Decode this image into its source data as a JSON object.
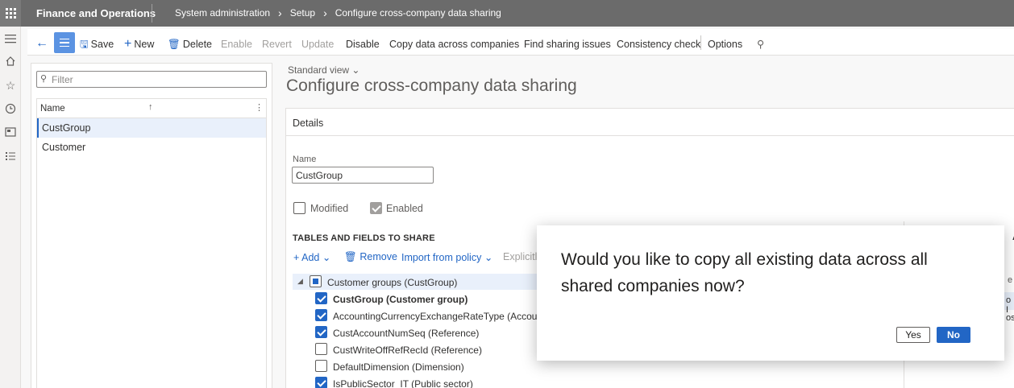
{
  "topbar": {
    "app_title": "Finance and Operations",
    "breadcrumbs": [
      "System administration",
      "Setup",
      "Configure cross-company data sharing"
    ]
  },
  "icons": {
    "waffle": "waffle-icon",
    "hamburger": "hamburger-icon",
    "home": "home-icon",
    "favorites": "star-icon",
    "recent": "clock-icon",
    "workspaces": "workspaces-icon",
    "modules": "list-icon"
  },
  "actionpane": {
    "save": "Save",
    "new": "New",
    "delete": "Delete",
    "enable": "Enable",
    "revert": "Revert",
    "update": "Update",
    "disable": "Disable",
    "copy_data": "Copy data across companies",
    "find_issues": "Find sharing issues",
    "consistency": "Consistency check",
    "options": "Options"
  },
  "list": {
    "filter_placeholder": "Filter",
    "column": "Name",
    "rows": [
      "CustGroup",
      "Customer"
    ]
  },
  "main": {
    "view": "Standard view",
    "title": "Configure cross-company data sharing",
    "details_header": "Details",
    "name_label": "Name",
    "name_value": "CustGroup",
    "modified_label": "Modified",
    "enabled_label": "Enabled",
    "section_title": "TABLES AND FIELDS TO SHARE",
    "toolbar": {
      "add": "Add",
      "remove": "Remove",
      "import": "Import from policy",
      "explicitly": "Explicitly"
    },
    "tree": {
      "root": "Customer groups (CustGroup)",
      "fields": [
        {
          "label": "CustGroup (Customer group)",
          "checked": true,
          "bold": true
        },
        {
          "label": "AccountingCurrencyExchangeRateType (Account",
          "checked": true,
          "bold": false
        },
        {
          "label": "CustAccountNumSeq (Reference)",
          "checked": true,
          "bold": false
        },
        {
          "label": "CustWriteOffRefRecId (Reference)",
          "checked": false,
          "bold": false
        },
        {
          "label": "DefaultDimension (Dimension)",
          "checked": false,
          "bold": false
        },
        {
          "label": "IsPublicSector_IT (Public sector)",
          "checked": true,
          "bold": false
        }
      ]
    },
    "right_pane": {
      "t1": "AR",
      "t2": "e",
      "t3": "o I",
      "t4": "ose"
    }
  },
  "dialog": {
    "message": "Would you like to copy all existing data across all shared companies now?",
    "yes": "Yes",
    "no": "No"
  },
  "colors": {
    "accent": "#2266c5",
    "topbar": "#6b6b6b",
    "selected_row": "#e9f0fb"
  }
}
